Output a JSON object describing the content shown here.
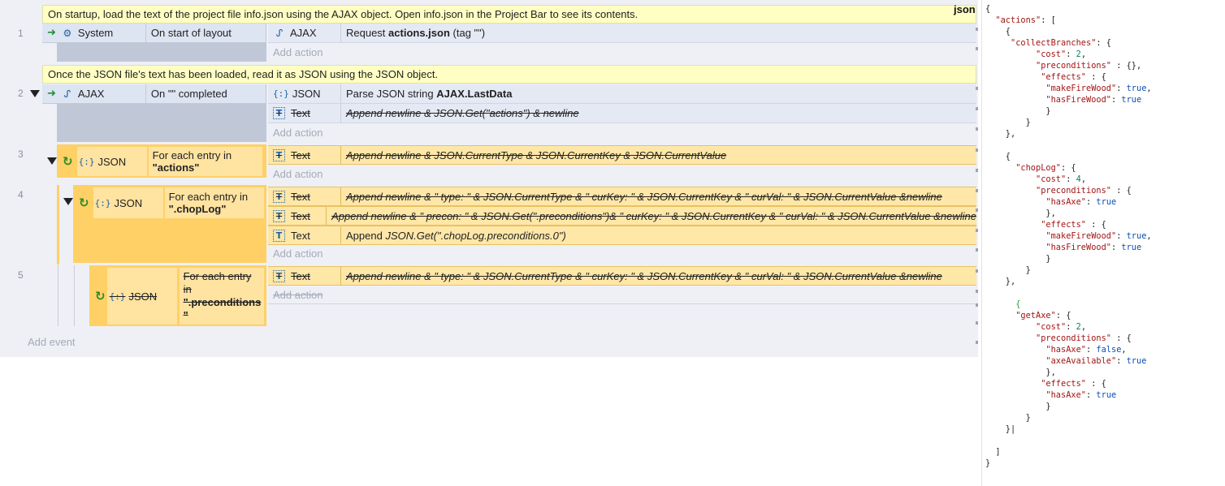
{
  "colors": {
    "accent": "#1d5fa8",
    "comment_bg": "#ffffc4",
    "loop_yellow": "#ffd066",
    "sheet_bg": "#eef0f6"
  },
  "tab_title": "json",
  "events": {
    "e1": {
      "comment": "On startup, load the text of the project file info.json using the AJAX object. Open info.json in the Project Bar to see its contents.",
      "row": "1",
      "cond_object": "System",
      "cond_text": "On start of layout",
      "actions": [
        {
          "object": "AJAX",
          "pre": "Request ",
          "bold": "actions.json",
          "post": " (tag \"\")"
        }
      ]
    },
    "e2": {
      "comment": "Once the JSON file's text has been loaded, read it as JSON using the JSON object.",
      "row": "2",
      "cond_object": "AJAX",
      "cond_text": "On \"\" completed",
      "actions": [
        {
          "object": "JSON",
          "pre": "Parse JSON string ",
          "bold": "AJAX.LastData"
        },
        {
          "object": "Text",
          "text": "Append newline & JSON.Get(\"actions\") & newline"
        }
      ]
    },
    "e3": {
      "row": "3",
      "cond_object": "JSON",
      "cond_line1": "For each entry in",
      "cond_line2": "\"actions\"",
      "actions": [
        {
          "object": "Text",
          "text": "Append newline & JSON.CurrentType & JSON.CurrentKey & JSON.CurrentValue"
        }
      ]
    },
    "e4": {
      "row": "4",
      "cond_object": "JSON",
      "cond_line1": "For each entry in",
      "cond_line2": "\".chopLog\"",
      "actions": [
        {
          "object": "Text",
          "text": "Append newline & \" type: \" & JSON.CurrentType & \" curKey: \" & JSON.CurrentKey & \" curVal: \" & JSON.CurrentValue &newline"
        },
        {
          "object": "Text",
          "text": "Append newline & \" precon: \" & JSON.Get(\".preconditions\")& \" curKey: \" & JSON.CurrentKey & \" curVal: \" & JSON.CurrentValue &newline"
        },
        {
          "object": "Text",
          "pre": "Append ",
          "italic": "JSON.Get(\".chopLog.preconditions.0\")",
          "post": ""
        }
      ]
    },
    "e5": {
      "row": "5",
      "cond_object": "JSON",
      "cond_line1": "For each entry",
      "cond_line2": "in",
      "cond_line3": "\".preconditions",
      "cond_line4": "\"",
      "actions": [
        {
          "object": "Text",
          "text": "Append newline & \" type: \" & JSON.CurrentType & \" curKey: \" & JSON.CurrentKey & \" curVal: \" & JSON.CurrentValue &newline"
        }
      ]
    }
  },
  "add_action": "Add action",
  "add_event": "Add event",
  "json_lines": [
    "{",
    "  \"actions\": [",
    "    {",
    "     \"collectBranches\": {",
    "          \"cost\": 2,",
    "          \"preconditions\" : {},",
    "           \"effects\" : {",
    "            \"makeFireWood\": true,",
    "            \"hasFireWood\": true",
    "            }",
    "        }",
    "    },",
    "",
    "    {",
    "      \"chopLog\": {",
    "          \"cost\": 4,",
    "          \"preconditions\" : {",
    "            \"hasAxe\": true",
    "            },",
    "           \"effects\" : {",
    "            \"makeFireWood\": true,",
    "            \"hasFireWood\": true",
    "            }",
    "        }",
    "    },",
    "",
    "      {",
    "      \"getAxe\": {",
    "          \"cost\": 2,",
    "          \"preconditions\" : {",
    "            \"hasAxe\": false,",
    "            \"axeAvailable\": true",
    "            },",
    "           \"effects\" : {",
    "            \"hasAxe\": true",
    "            }",
    "        }",
    "    }|",
    "",
    "  ]",
    "}"
  ]
}
